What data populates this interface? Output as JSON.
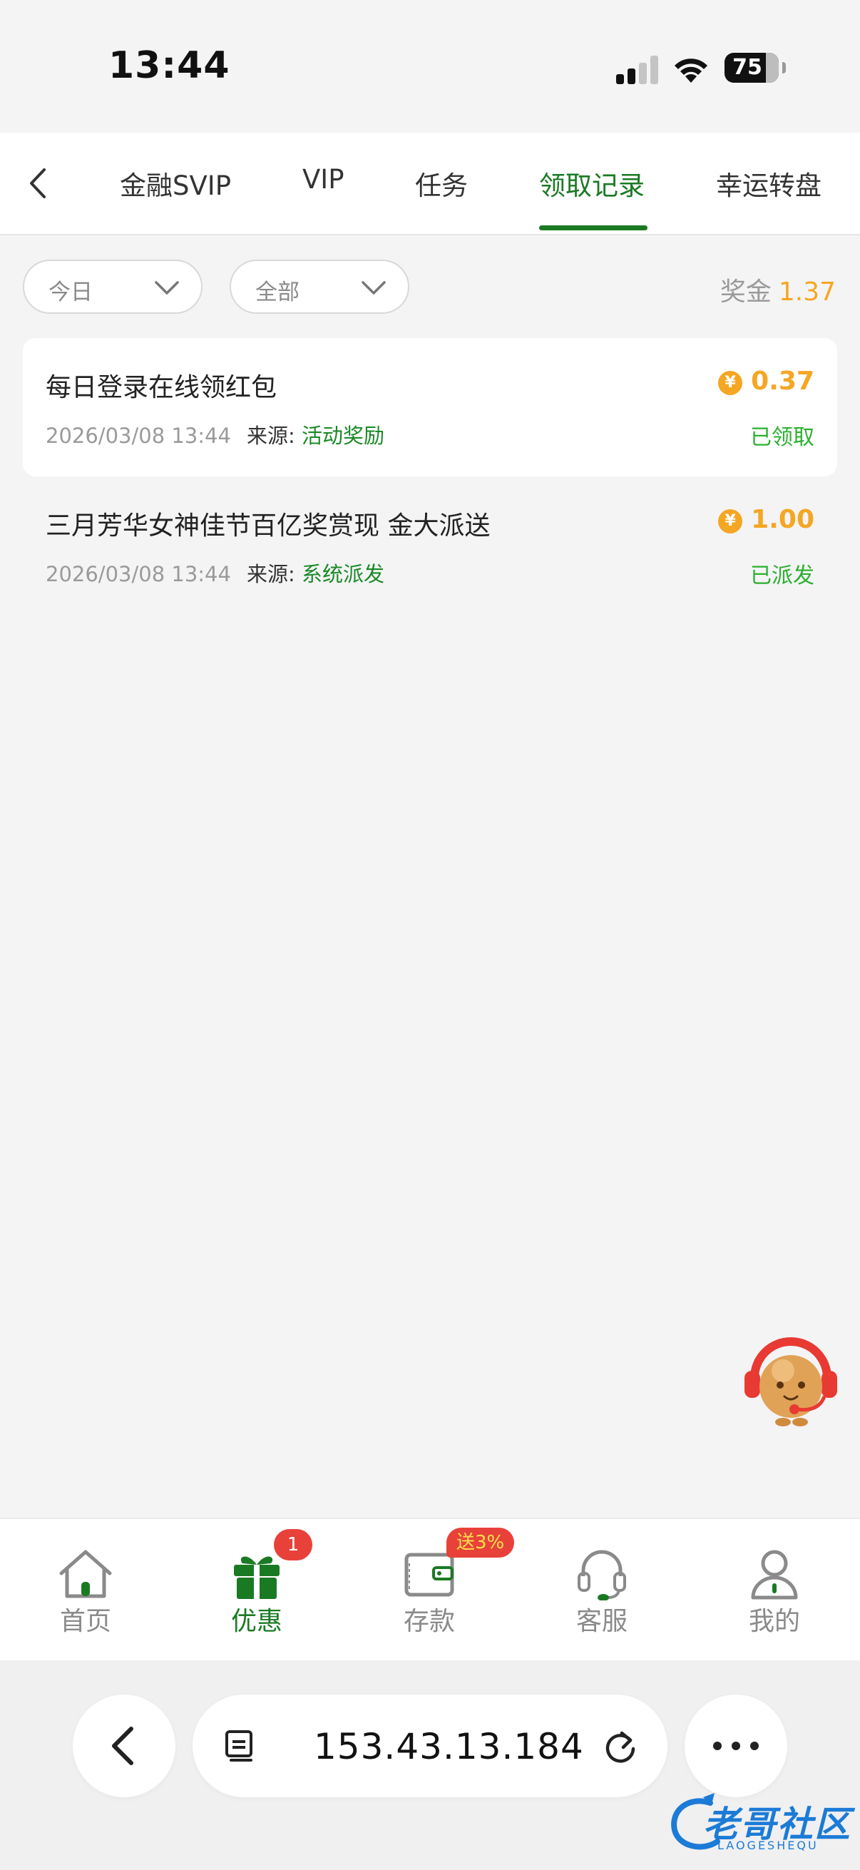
{
  "status_bar": {
    "time": "13:44",
    "battery": "75",
    "icons": [
      "cellular-signal-icon",
      "wifi-icon",
      "battery-icon"
    ]
  },
  "tabs": {
    "back_icon": "chevron-left-icon",
    "items": [
      {
        "label": "金融SVIP",
        "active": false
      },
      {
        "label": "VIP",
        "active": false
      },
      {
        "label": "任务",
        "active": false
      },
      {
        "label": "领取记录",
        "active": true
      },
      {
        "label": "幸运转盘",
        "active": false
      }
    ]
  },
  "filters": {
    "date": {
      "value": "今日",
      "icon": "chevron-down-icon"
    },
    "type": {
      "value": "全部",
      "icon": "chevron-down-icon"
    },
    "bonus_label": "奖金",
    "bonus_value": "1.37"
  },
  "records": [
    {
      "title": "每日登录在线领红包",
      "datetime": "2026/03/08 13:44",
      "source_label": "来源:",
      "source_value": "活动奖励",
      "coin_symbol": "¥",
      "amount": "0.37",
      "status": "已领取"
    },
    {
      "title": "三月芳华女神佳节百亿奖赏现 金大派送",
      "datetime": "2026/03/08 13:44",
      "source_label": "来源:",
      "source_value": "系统派发",
      "coin_symbol": "¥",
      "amount": "1.00",
      "status": "已派发"
    }
  ],
  "bottom_nav": {
    "items": [
      {
        "label": "首页",
        "icon": "home-icon",
        "active": false
      },
      {
        "label": "优惠",
        "icon": "gift-icon",
        "active": true,
        "badge": "1"
      },
      {
        "label": "存款",
        "icon": "wallet-icon",
        "active": false,
        "badge": "送3%"
      },
      {
        "label": "客服",
        "icon": "headset-icon",
        "active": false
      },
      {
        "label": "我的",
        "icon": "user-icon",
        "active": false
      }
    ]
  },
  "browser": {
    "url": "153.43.13.184",
    "icons": [
      "back-icon",
      "reader-icon",
      "reload-icon",
      "more-icon"
    ]
  },
  "watermark": {
    "text": "老哥社区",
    "sub": "LAOGESHEQU"
  },
  "colors": {
    "accent_green": "#1a7a23",
    "amount_orange": "#f5a623",
    "status_green": "#2bb02f",
    "badge_red": "#e8413a"
  }
}
